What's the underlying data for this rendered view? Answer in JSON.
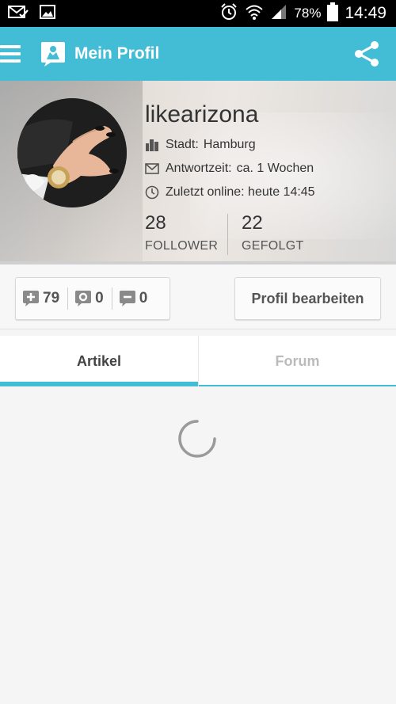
{
  "status_bar": {
    "battery": "78%",
    "time": "14:49",
    "icons": [
      "mail-check-icon",
      "image-icon",
      "alarm-icon",
      "wifi-icon",
      "signal-icon",
      "battery-icon"
    ]
  },
  "app_bar": {
    "title": "Mein Profil",
    "icons": [
      "menu-icon",
      "app-logo-icon",
      "share-icon"
    ]
  },
  "profile": {
    "username": "likearizona",
    "city_label": "Stadt:",
    "city": "Hamburg",
    "response_label": "Antwortzeit:",
    "response": "ca. 1 Wochen",
    "last_online": "Zuletzt online: heute 14:45",
    "followers_count": "28",
    "followers_label": "FOLLOWER",
    "following_count": "22",
    "following_label": "GEFOLGT"
  },
  "actions": {
    "plus_count": "79",
    "neutral_count": "0",
    "minus_count": "0",
    "edit_label": "Profil bearbeiten"
  },
  "tabs": [
    {
      "label": "Artikel",
      "active": true
    },
    {
      "label": "Forum",
      "active": false
    }
  ],
  "colors": {
    "accent": "#43bcd5",
    "status_bar": "#000000",
    "text": "#333333"
  }
}
